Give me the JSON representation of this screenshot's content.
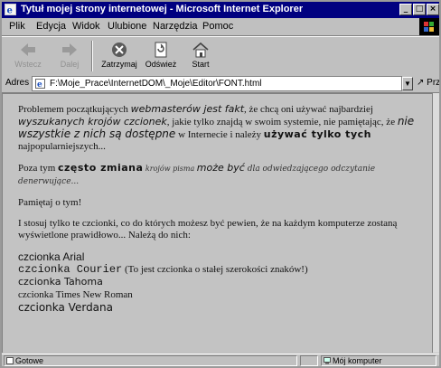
{
  "window": {
    "title": "Tytuł mojej strony internetowej - Microsoft Internet Explorer"
  },
  "menu": {
    "items": [
      "Plik",
      "Edycja",
      "Widok",
      "Ulubione",
      "Narzędzia",
      "Pomoc"
    ]
  },
  "toolbar": {
    "buttons": [
      {
        "label": "Wstecz",
        "icon": "back-arrow-icon",
        "enabled": false
      },
      {
        "label": "Dalej",
        "icon": "forward-arrow-icon",
        "enabled": false
      },
      {
        "label": "Zatrzymaj",
        "icon": "stop-icon",
        "enabled": true
      },
      {
        "label": "Odśwież",
        "icon": "refresh-icon",
        "enabled": true
      },
      {
        "label": "Start",
        "icon": "home-icon",
        "enabled": true
      }
    ]
  },
  "address": {
    "label": "Adres",
    "url": "F:\\Moje_Prace\\InternetDOM\\_Moje\\Editor\\FONT.html",
    "go_label": "Przejdź"
  },
  "content": {
    "p1": {
      "t1": "Problemem początkujących ",
      "t2": "webmasterów jest fakt",
      "t3": ", że chcą oni używać najbardziej ",
      "t4": "wyszukanych krojów czcionek",
      "t5": ", jakie tylko znajdą w swoim systemie, nie pamiętając, że ",
      "t6": "nie wszystkie z nich są dostępne",
      "t7": " w Internecie i należy ",
      "t8": "używać tylko tych",
      "t9": " najpopularniejszych..."
    },
    "p2": {
      "t1": "Poza tym ",
      "t2": "często zmiana",
      "t3": " krojów pisma ",
      "t4": "może być",
      "t5": " dla odwiedzającego odczytanie denerwujące..."
    },
    "p3": "Pamiętaj o tym!",
    "p4": "I stosuj tylko te czcionki, co do których możesz być pewien, że na każdym komputerze zostaną wyświetlone prawidłowo... Należą do nich:",
    "fonts": {
      "arial": "czcionka Arial",
      "courier": "czcionka Courier",
      "courier_note": " (To jest czcionka o stałej szerokości znaków!)",
      "tahoma": "czcionka Tahoma",
      "times": "czcionka Times New Roman",
      "verdana": "czcionka Verdana"
    }
  },
  "status": {
    "left": "Gotowe",
    "zone": "Mój komputer"
  }
}
